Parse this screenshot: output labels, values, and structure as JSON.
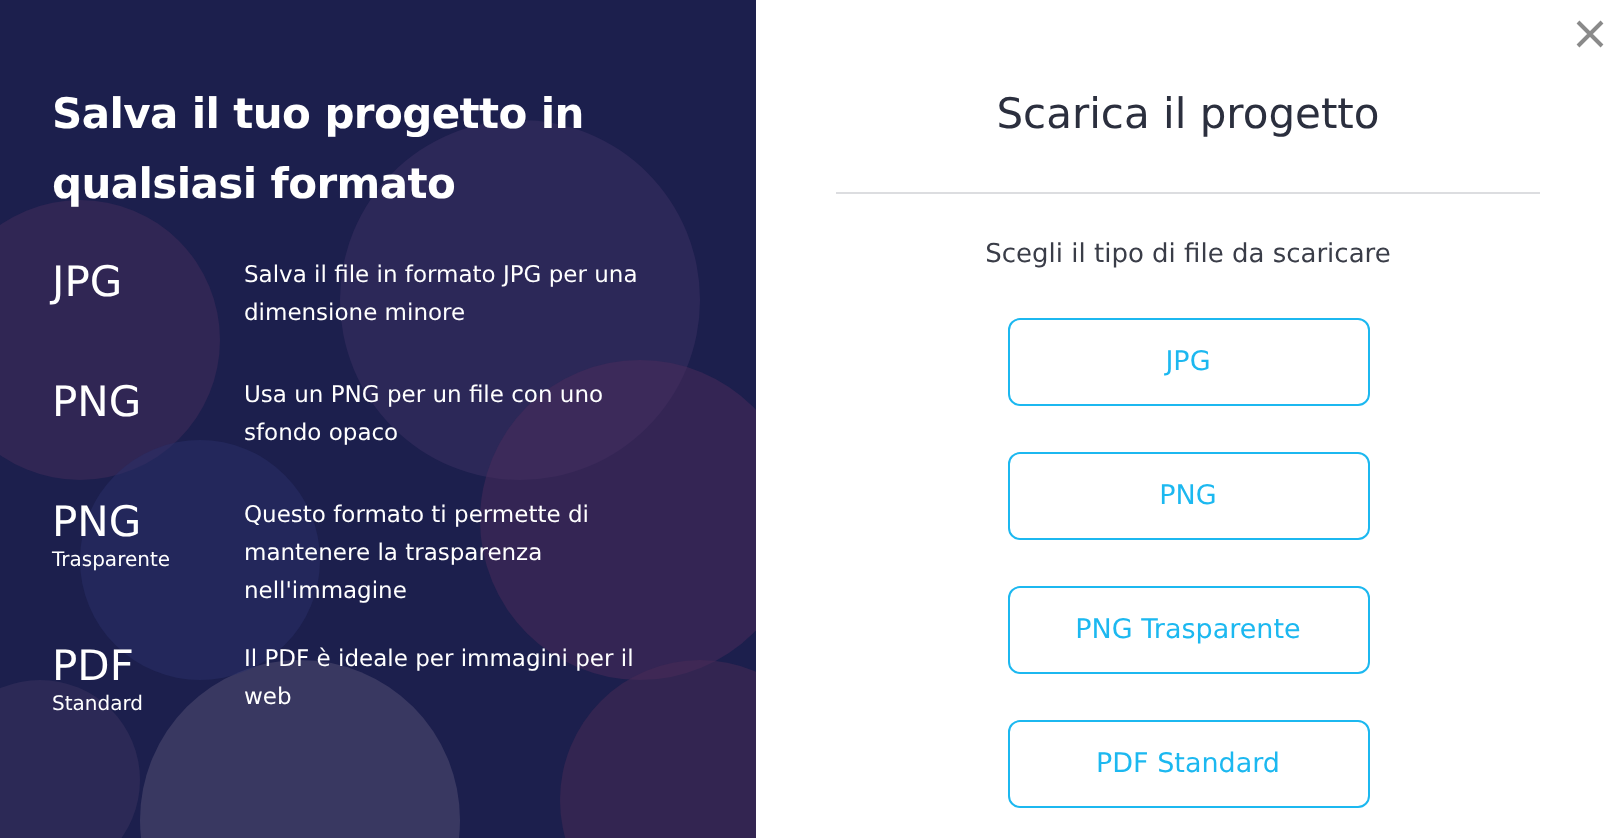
{
  "info_panel": {
    "title": "Salva il tuo progetto in qualsiasi formato",
    "formats": [
      {
        "name": "JPG",
        "description": "Salva il file in formato JPG per una dimensione minore"
      },
      {
        "name": "PNG",
        "description": "Usa un PNG per un file con uno sfondo opaco"
      },
      {
        "name": "PNG",
        "variant": "Trasparente",
        "description": "Questo formato ti permette di mantenere la trasparenza nell'immagine"
      },
      {
        "name": "PDF",
        "variant": "Standard",
        "description": "Il PDF è ideale per immagini per il web"
      }
    ]
  },
  "dialog": {
    "title": "Scarica il progetto",
    "subtitle": "Scegli il tipo di file da scaricare",
    "buttons": [
      "JPG",
      "PNG",
      "PNG Trasparente",
      "PDF Standard"
    ]
  }
}
